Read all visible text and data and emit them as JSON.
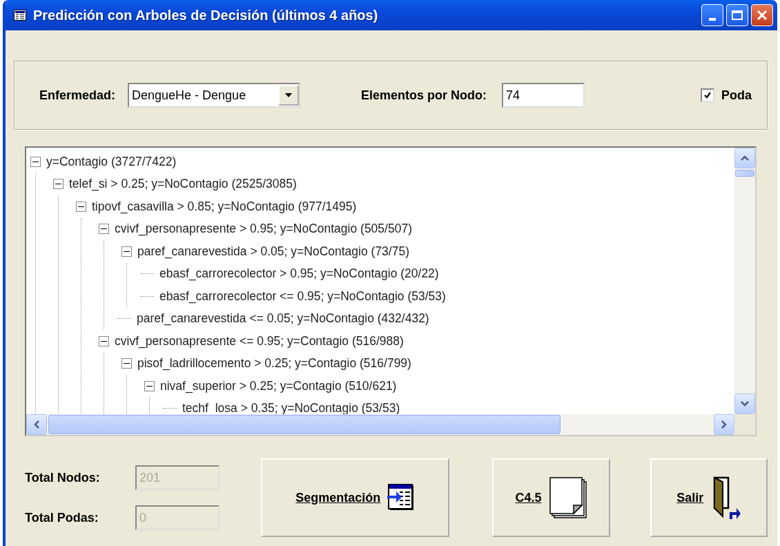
{
  "window": {
    "title": "Predicción con Arboles de Decisión (últimos 4 años)"
  },
  "filters": {
    "disease_label": "Enfermedad:",
    "disease_value": "DengueHe - Dengue",
    "elements_label": "Elementos por Nodo:",
    "elements_value": "74",
    "prune_label": "Poda",
    "prune_checked": true
  },
  "tree": [
    {
      "text": "y=Contagio (3727/7422)",
      "expanded": true,
      "children": [
        {
          "text": "telef_si > 0.25; y=NoContagio (2525/3085)",
          "expanded": true,
          "children": [
            {
              "text": "tipovf_casavilla > 0.85; y=NoContagio (977/1495)",
              "expanded": true,
              "children": [
                {
                  "text": "cvivf_personapresente > 0.95; y=NoContagio (505/507)",
                  "expanded": true,
                  "children": [
                    {
                      "text": "paref_canarevestida > 0.05; y=NoContagio (73/75)",
                      "expanded": true,
                      "children": [
                        {
                          "text": "ebasf_carrorecolector > 0.95; y=NoContagio (20/22)"
                        },
                        {
                          "text": "ebasf_carrorecolector <= 0.95; y=NoContagio (53/53)"
                        }
                      ]
                    },
                    {
                      "text": "paref_canarevestida <= 0.05; y=NoContagio (432/432)"
                    }
                  ]
                },
                {
                  "text": "cvivf_personapresente <= 0.95; y=Contagio (516/988)",
                  "expanded": true,
                  "children": [
                    {
                      "text": "pisof_ladrillocemento > 0.25; y=Contagio (516/799)",
                      "expanded": true,
                      "children": [
                        {
                          "text": "nivaf_superior > 0.25; y=Contagio (510/621)",
                          "expanded": true,
                          "children": [
                            {
                              "text": "techf_losa > 0.35; y=NoContagio (53/53)"
                            }
                          ]
                        }
                      ]
                    }
                  ]
                }
              ]
            }
          ]
        }
      ]
    }
  ],
  "totals": [
    {
      "label": "Total Nodos:",
      "value": "201"
    },
    {
      "label": "Total Podas:",
      "value": "0"
    }
  ],
  "buttons": [
    {
      "kind": "segment",
      "label": "Segmentación"
    },
    {
      "kind": "c45",
      "label": "C4.5"
    },
    {
      "kind": "exit",
      "label": "Salir"
    }
  ]
}
